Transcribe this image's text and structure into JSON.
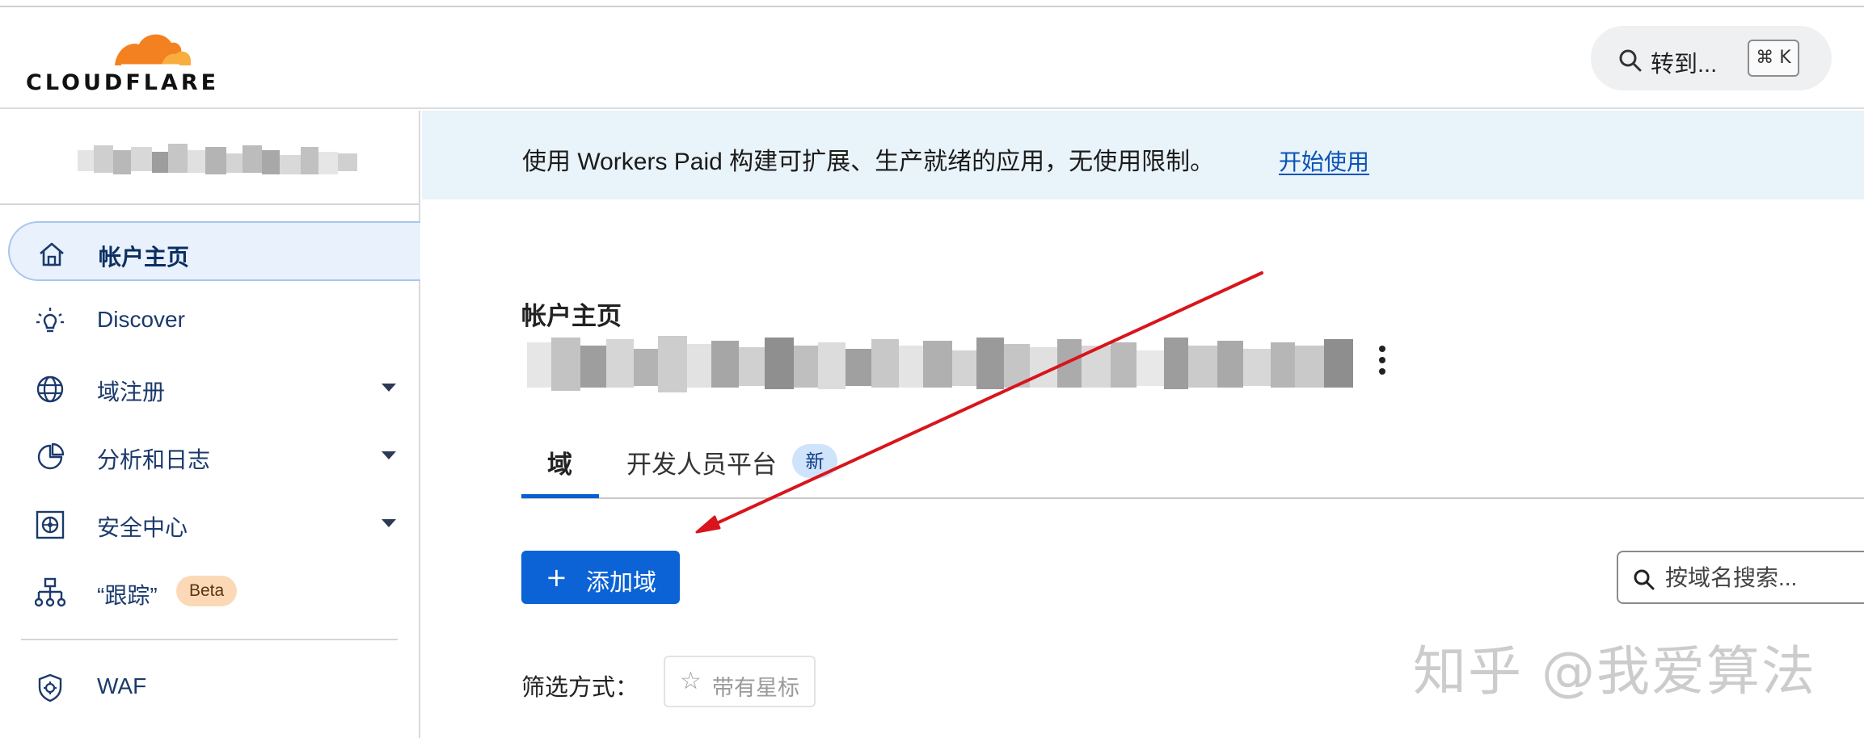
{
  "brand": {
    "logo_text": "CLOUDFLARE",
    "orange": "#f48120",
    "light_orange": "#faad3f"
  },
  "search_shortcut": {
    "label": "转到...",
    "key_hint": "⌘ K",
    "icon": "search-icon"
  },
  "sidebar": {
    "items": [
      {
        "label": "帐户主页",
        "icon": "home-icon",
        "active": true,
        "has_caret": false
      },
      {
        "label": "Discover",
        "icon": "lightbulb-icon",
        "active": false,
        "has_caret": false
      },
      {
        "label": "域注册",
        "icon": "globe-icon",
        "active": false,
        "has_caret": true
      },
      {
        "label": "分析和日志",
        "icon": "pie-chart-icon",
        "active": false,
        "has_caret": true
      },
      {
        "label": "安全中心",
        "icon": "security-center-icon",
        "active": false,
        "has_caret": true
      },
      {
        "label": "“跟踪”",
        "icon": "network-tree-icon",
        "active": false,
        "has_caret": false,
        "badge": "Beta"
      },
      {
        "label": "WAF",
        "icon": "shield-gear-icon",
        "active": false,
        "has_caret": false
      }
    ]
  },
  "banner": {
    "text": "使用 Workers Paid 构建可扩展、生产就绪的应用，无使用限制。",
    "link": "开始使用"
  },
  "main": {
    "title": "帐户主页",
    "tabs": [
      {
        "label": "域",
        "active": true
      },
      {
        "label": "开发人员平台",
        "active": false,
        "badge": "新"
      }
    ],
    "add_button": {
      "icon": "+",
      "label": "添加域"
    },
    "search": {
      "placeholder": "按域名搜索..."
    },
    "filter": {
      "label": "筛选方式：",
      "chip_icon": "☆",
      "chip_label": "带有星标"
    }
  },
  "colors": {
    "accent_blue": "#0b63d6",
    "banner_bg": "#e8f3fa",
    "annotation_red": "#d8151c"
  },
  "watermark": "知乎 @我爱算法"
}
